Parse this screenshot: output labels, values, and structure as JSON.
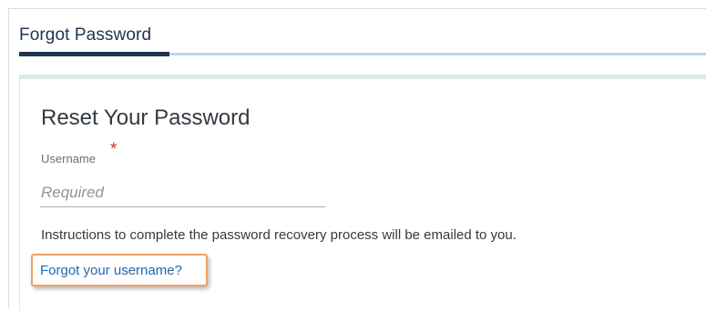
{
  "header": {
    "title": "Forgot Password"
  },
  "card": {
    "title": "Reset Your Password",
    "username": {
      "label": "Username",
      "required_marker": "*",
      "placeholder": "Required",
      "value": ""
    },
    "instructions": "Instructions to complete the password recovery process will be emailed to you.",
    "forgot_username_link": "Forgot your username?"
  },
  "colors": {
    "header_text": "#1f3550",
    "header_rule": "#b9d8f3",
    "header_rule_active": "#1f3550",
    "link": "#1c6ab1",
    "required": "#d0332b",
    "highlight": "#f0a060"
  }
}
